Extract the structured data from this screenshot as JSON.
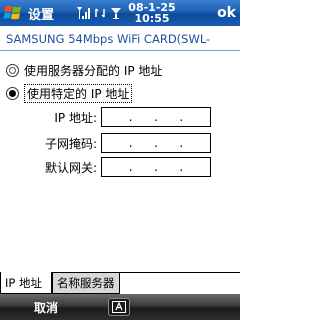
{
  "titlebar": {
    "title": "设置",
    "date": "08-1-25",
    "time": "10:55",
    "ok_label": "ok",
    "icons": [
      "windows-start-icon",
      "signal-icon",
      "connectivity-icon",
      "volume-icon"
    ]
  },
  "header": {
    "adapter_name": "SAMSUNG 54Mbps WiFi CARD(SWL-"
  },
  "options": {
    "auto_ip_label": "使用服务器分配的 IP 地址",
    "specific_ip_label": "使用特定的 IP 地址",
    "selected": "specific_ip"
  },
  "fields": {
    "ip_label": "IP 地址:",
    "subnet_label": "子网掩码:",
    "gateway_label": "默认网关:",
    "ip_value": "",
    "subnet_value": "",
    "gateway_value": ""
  },
  "tabs": [
    {
      "label": "IP 地址",
      "active": true
    },
    {
      "label": "名称服务器",
      "active": false
    }
  ],
  "softkeys": {
    "left": "取消"
  },
  "colors": {
    "titlebar": "#1c5fb3",
    "subtitle_text": "#1f4fa0",
    "softbar": "#2e2e2e"
  }
}
